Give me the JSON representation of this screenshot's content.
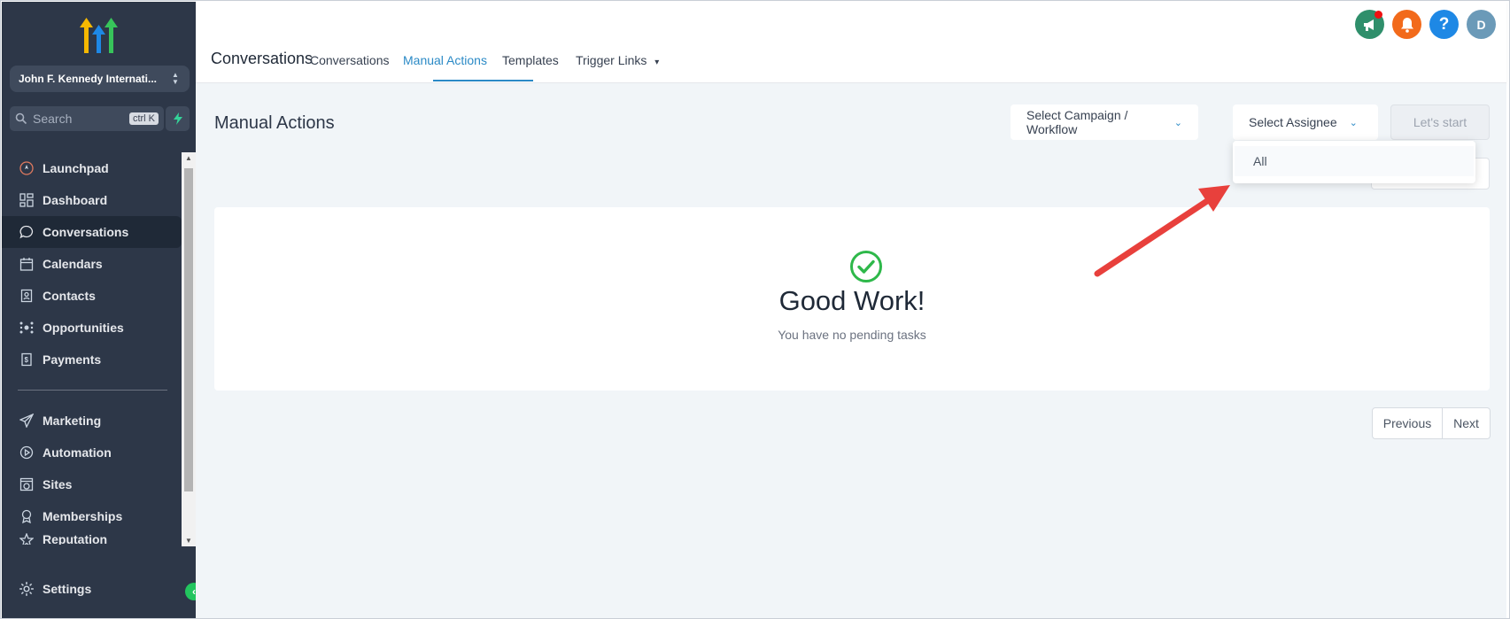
{
  "sidebar": {
    "account_name": "John F. Kennedy Internati...",
    "search_placeholder": "Search",
    "search_shortcut": "ctrl K",
    "items": [
      {
        "label": "Launchpad",
        "icon": "rocket-icon"
      },
      {
        "label": "Dashboard",
        "icon": "grid-icon"
      },
      {
        "label": "Conversations",
        "icon": "chat-bubble-icon",
        "active": true
      },
      {
        "label": "Calendars",
        "icon": "calendar-icon"
      },
      {
        "label": "Contacts",
        "icon": "address-book-icon"
      },
      {
        "label": "Opportunities",
        "icon": "network-icon"
      },
      {
        "label": "Payments",
        "icon": "dollar-receipt-icon"
      }
    ],
    "items2": [
      {
        "label": "Marketing",
        "icon": "paper-plane-icon"
      },
      {
        "label": "Automation",
        "icon": "play-circle-icon"
      },
      {
        "label": "Sites",
        "icon": "globe-window-icon"
      },
      {
        "label": "Memberships",
        "icon": "award-icon"
      },
      {
        "label": "Reputation",
        "icon": "star-icon"
      }
    ],
    "settings_label": "Settings"
  },
  "header": {
    "title": "Conversations",
    "tabs": [
      {
        "label": "Conversations"
      },
      {
        "label": "Manual Actions",
        "active": true
      },
      {
        "label": "Templates"
      },
      {
        "label": "Trigger Links"
      }
    ],
    "avatar_initial": "D",
    "colors": {
      "megaphone": "#2f8f6b",
      "bell": "#f26a1b",
      "help": "#1e88e5",
      "avatar": "#6b9ab8"
    }
  },
  "main": {
    "page_title": "Manual Actions",
    "campaign_select": "Select Campaign / Workflow",
    "assignee_select": "Select Assignee",
    "start_button": "Let's start",
    "dropdown_options": [
      "All"
    ],
    "empty_title": "Good Work!",
    "empty_subtitle": "You have no pending tasks",
    "pager": {
      "previous": "Previous",
      "next": "Next"
    }
  },
  "colors": {
    "accent": "#2b8ac6",
    "success": "#2eb84a",
    "annotation_arrow": "#e8403c",
    "sidebar_bg": "#2d3748"
  }
}
